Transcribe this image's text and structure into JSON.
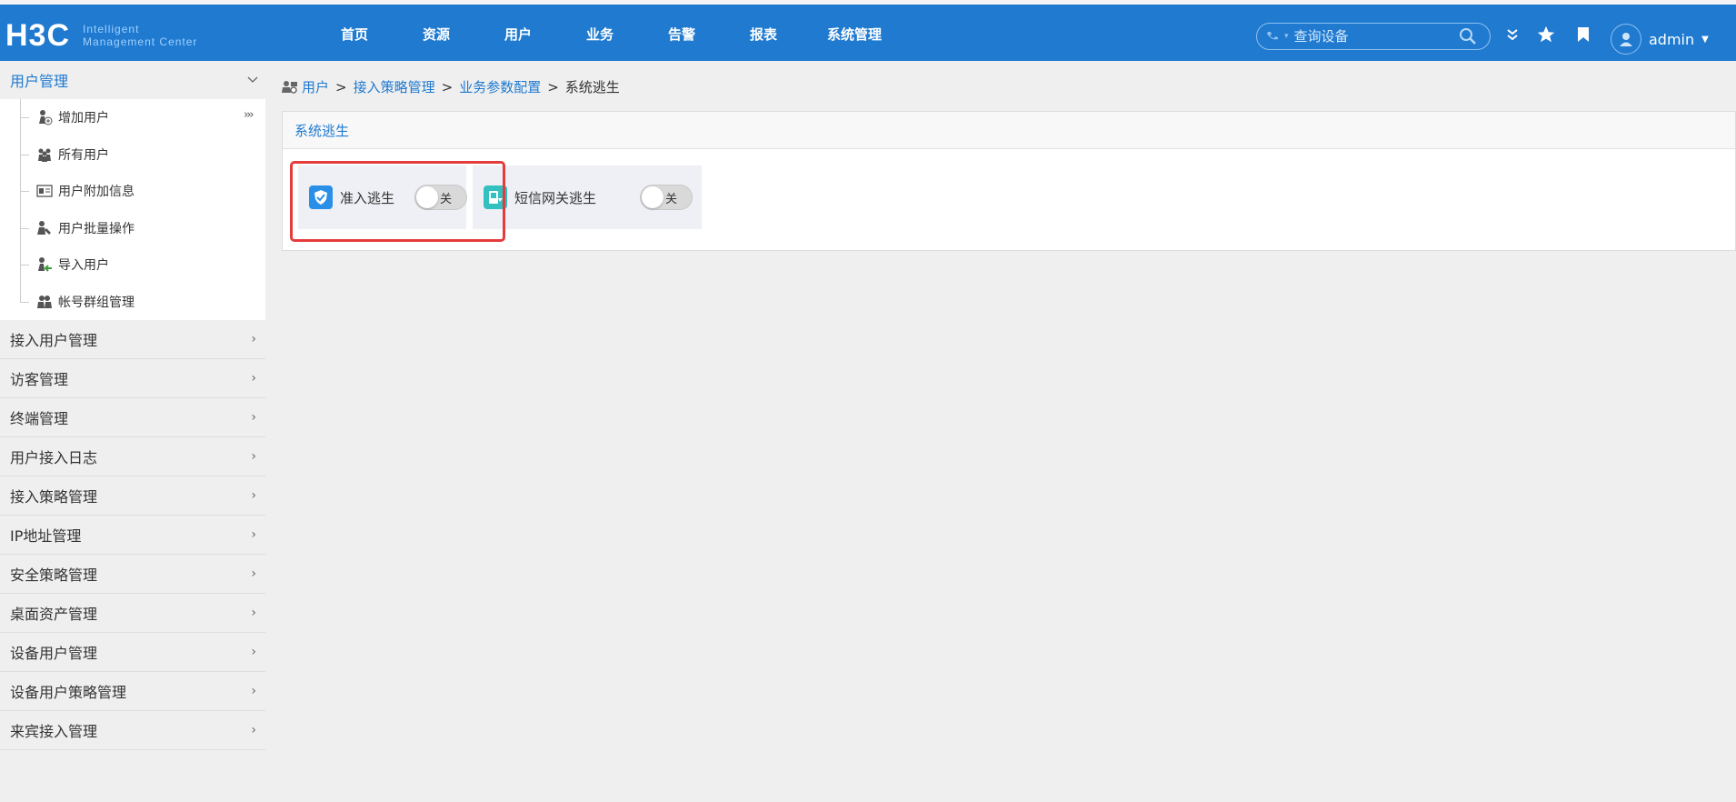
{
  "header": {
    "logo_main": "H3C",
    "logo_sub_line1": "Intelligent",
    "logo_sub_line2": "Management Center",
    "nav": [
      "首页",
      "资源",
      "用户",
      "业务",
      "告警",
      "报表",
      "系统管理"
    ],
    "search_placeholder": "查询设备",
    "username": "admin",
    "colors": {
      "primary": "#1f7ad0",
      "highlight": "#e53b3b"
    }
  },
  "sidebar": {
    "section_title": "用户管理",
    "sub_items": [
      {
        "label": "增加用户",
        "icon": "add-user-icon"
      },
      {
        "label": "所有用户",
        "icon": "all-users-icon"
      },
      {
        "label": "用户附加信息",
        "icon": "user-info-icon"
      },
      {
        "label": "用户批量操作",
        "icon": "batch-user-icon"
      },
      {
        "label": "导入用户",
        "icon": "import-user-icon"
      },
      {
        "label": "帐号群组管理",
        "icon": "group-icon"
      }
    ],
    "collapse_glyph": "›››",
    "menu": [
      "接入用户管理",
      "访客管理",
      "终端管理",
      "用户接入日志",
      "接入策略管理",
      "IP地址管理",
      "安全策略管理",
      "桌面资产管理",
      "设备用户管理",
      "设备用户策略管理",
      "来宾接入管理"
    ]
  },
  "breadcrumb": {
    "items": [
      "用户",
      "接入策略管理",
      "业务参数配置"
    ],
    "current": "系统逃生",
    "separator": ">"
  },
  "panel": {
    "title": "系统逃生",
    "cards": [
      {
        "label": "准入逃生",
        "toggle_text": "关",
        "toggle_on": false,
        "icon_color": "#2a8fe6"
      },
      {
        "label": "短信网关逃生",
        "toggle_text": "关",
        "toggle_on": false,
        "icon_color": "#33c0c0"
      }
    ]
  }
}
